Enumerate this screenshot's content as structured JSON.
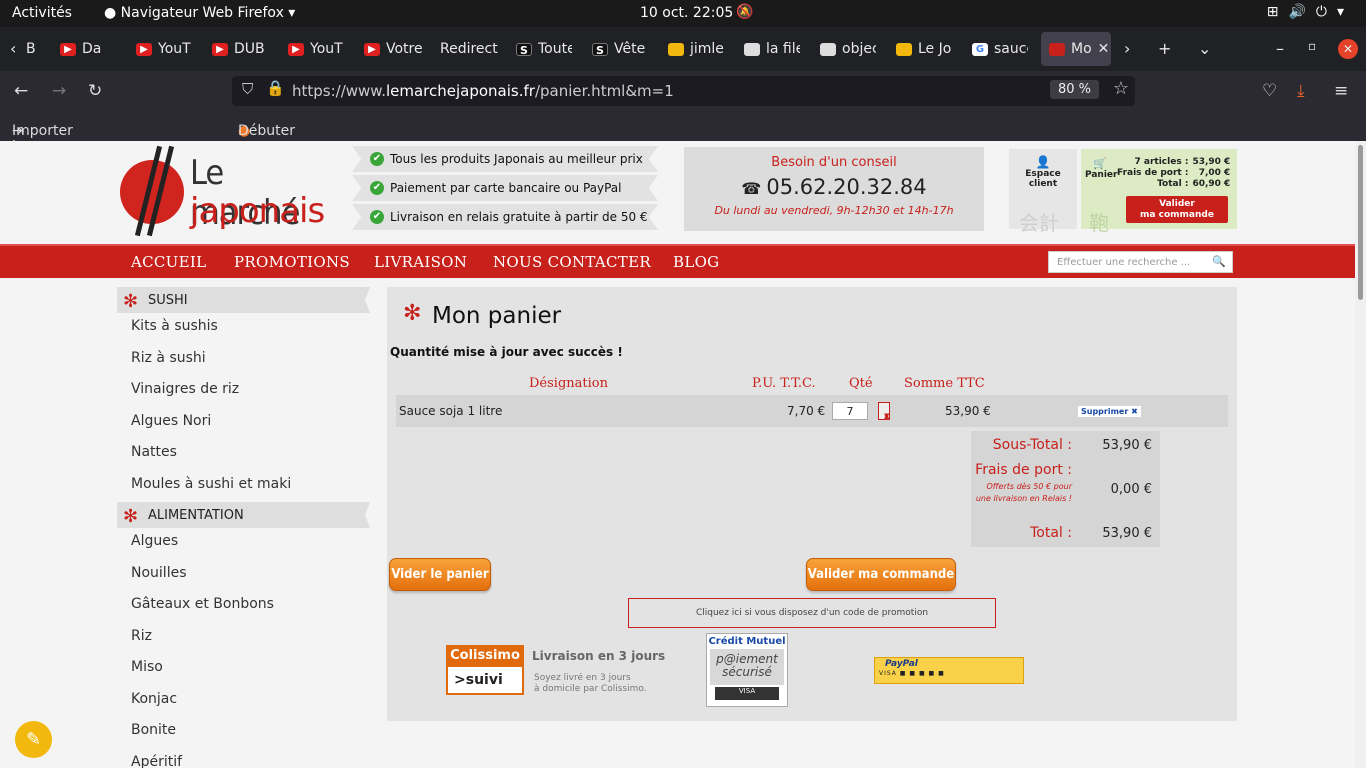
{
  "system": {
    "activities": "Activités",
    "app": "Navigateur Web Firefox ▾",
    "clock": "10 oct.  22:05"
  },
  "tabs": [
    {
      "label": "B"
    },
    {
      "label": "Da"
    },
    {
      "label": "YouT"
    },
    {
      "label": "DUB"
    },
    {
      "label": "YouT"
    },
    {
      "label": "Votre"
    },
    {
      "label": "Redirect"
    },
    {
      "label": "Toute"
    },
    {
      "label": "Vête"
    },
    {
      "label": "jimle"
    },
    {
      "label": "la file"
    },
    {
      "label": "objec"
    },
    {
      "label": "Le Jo"
    },
    {
      "label": "sauce"
    },
    {
      "label": "Mo"
    }
  ],
  "browser": {
    "url_prefix": "https://www.",
    "url_host": "lemarchejaponais.fr",
    "url_path": "/panier.html&m=1",
    "zoom": "80 %"
  },
  "bookmarks": {
    "import": "Importer les marque-pages…",
    "start": "Débuter avec Firefox"
  },
  "site": {
    "logo_line1": "Le marché",
    "logo_line2": "japonais",
    "features": [
      "Tous les produits Japonais au meilleur prix",
      "Paiement par carte bancaire ou PayPal",
      "Livraison en relais gratuite à partir de 50 €"
    ],
    "conseil": {
      "title": "Besoin d'un conseil",
      "phone": "05.62.20.32.84",
      "hours": "Du lundi au vendredi, 9h-12h30 et 14h-17h"
    },
    "espace": {
      "l1": "Espace",
      "l2": "client",
      "kanji": "会計"
    },
    "panier": {
      "label": "Panier",
      "kanji": "鞄",
      "rows": [
        [
          "7 articles :",
          "53,90 €"
        ],
        [
          "Frais de port :",
          "7,00 €"
        ],
        [
          "Total :",
          "60,90 €"
        ]
      ],
      "btn_l1": "Valider",
      "btn_l2": "ma commande"
    },
    "menu": [
      "ACCUEIL",
      "PROMOTIONS",
      "LIVRAISON",
      "NOUS CONTACTER",
      "BLOG"
    ],
    "search_placeholder": "Effectuer une recherche ...",
    "sidebar": {
      "cat1": "SUSHI",
      "items1": [
        "Kits à sushis",
        "Riz à sushi",
        "Vinaigres de riz",
        "Algues Nori",
        "Nattes",
        "Moules à sushi et maki"
      ],
      "cat2": "ALIMENTATION",
      "items2": [
        "Algues",
        "Nouilles",
        "Gâteaux et Bonbons",
        "Riz",
        "Miso",
        "Konjac",
        "Bonite",
        "Apéritif"
      ]
    },
    "cart": {
      "title": "Mon panier",
      "message": "Quantité mise à jour avec succès !",
      "headers": {
        "designation": "Désignation",
        "pu": "P.U. T.T.C.",
        "qte": "Qté",
        "somme": "Somme TTC"
      },
      "item": {
        "name": "Sauce soja 1 litre",
        "price": "7,70 €",
        "qty": "7",
        "sum": "53,90 €",
        "delete": "Supprimer ✖"
      },
      "subtotal_label": "Sous-Total :",
      "subtotal": "53,90 €",
      "port_label": "Frais de port :",
      "port_note": "Offerts dès 50 € pour une livraison en Relais !",
      "port": "0,00 €",
      "total_label": "Total :",
      "total": "53,90 €",
      "btn_vider": "Vider le panier",
      "btn_valider": "Valider ma commande",
      "promo": "Cliquez ici si vous disposez d'un code de promotion"
    },
    "footer_logos": {
      "colis_a": "Colissimo",
      "colis_b": ">suivi",
      "colis_t": "Livraison en 3 jours",
      "colis_s1": "Soyez livré en 3 jours",
      "colis_s2": "à domicile par Colissimo.",
      "cm_a": "Crédit Mutuel",
      "cm_b1": "p@iement",
      "cm_b2": "sécurisé",
      "cm_c": "VISA",
      "paypal_a": "PayPal",
      "paypal_b": "VISA ■ ■ ■ ■ ■"
    }
  }
}
